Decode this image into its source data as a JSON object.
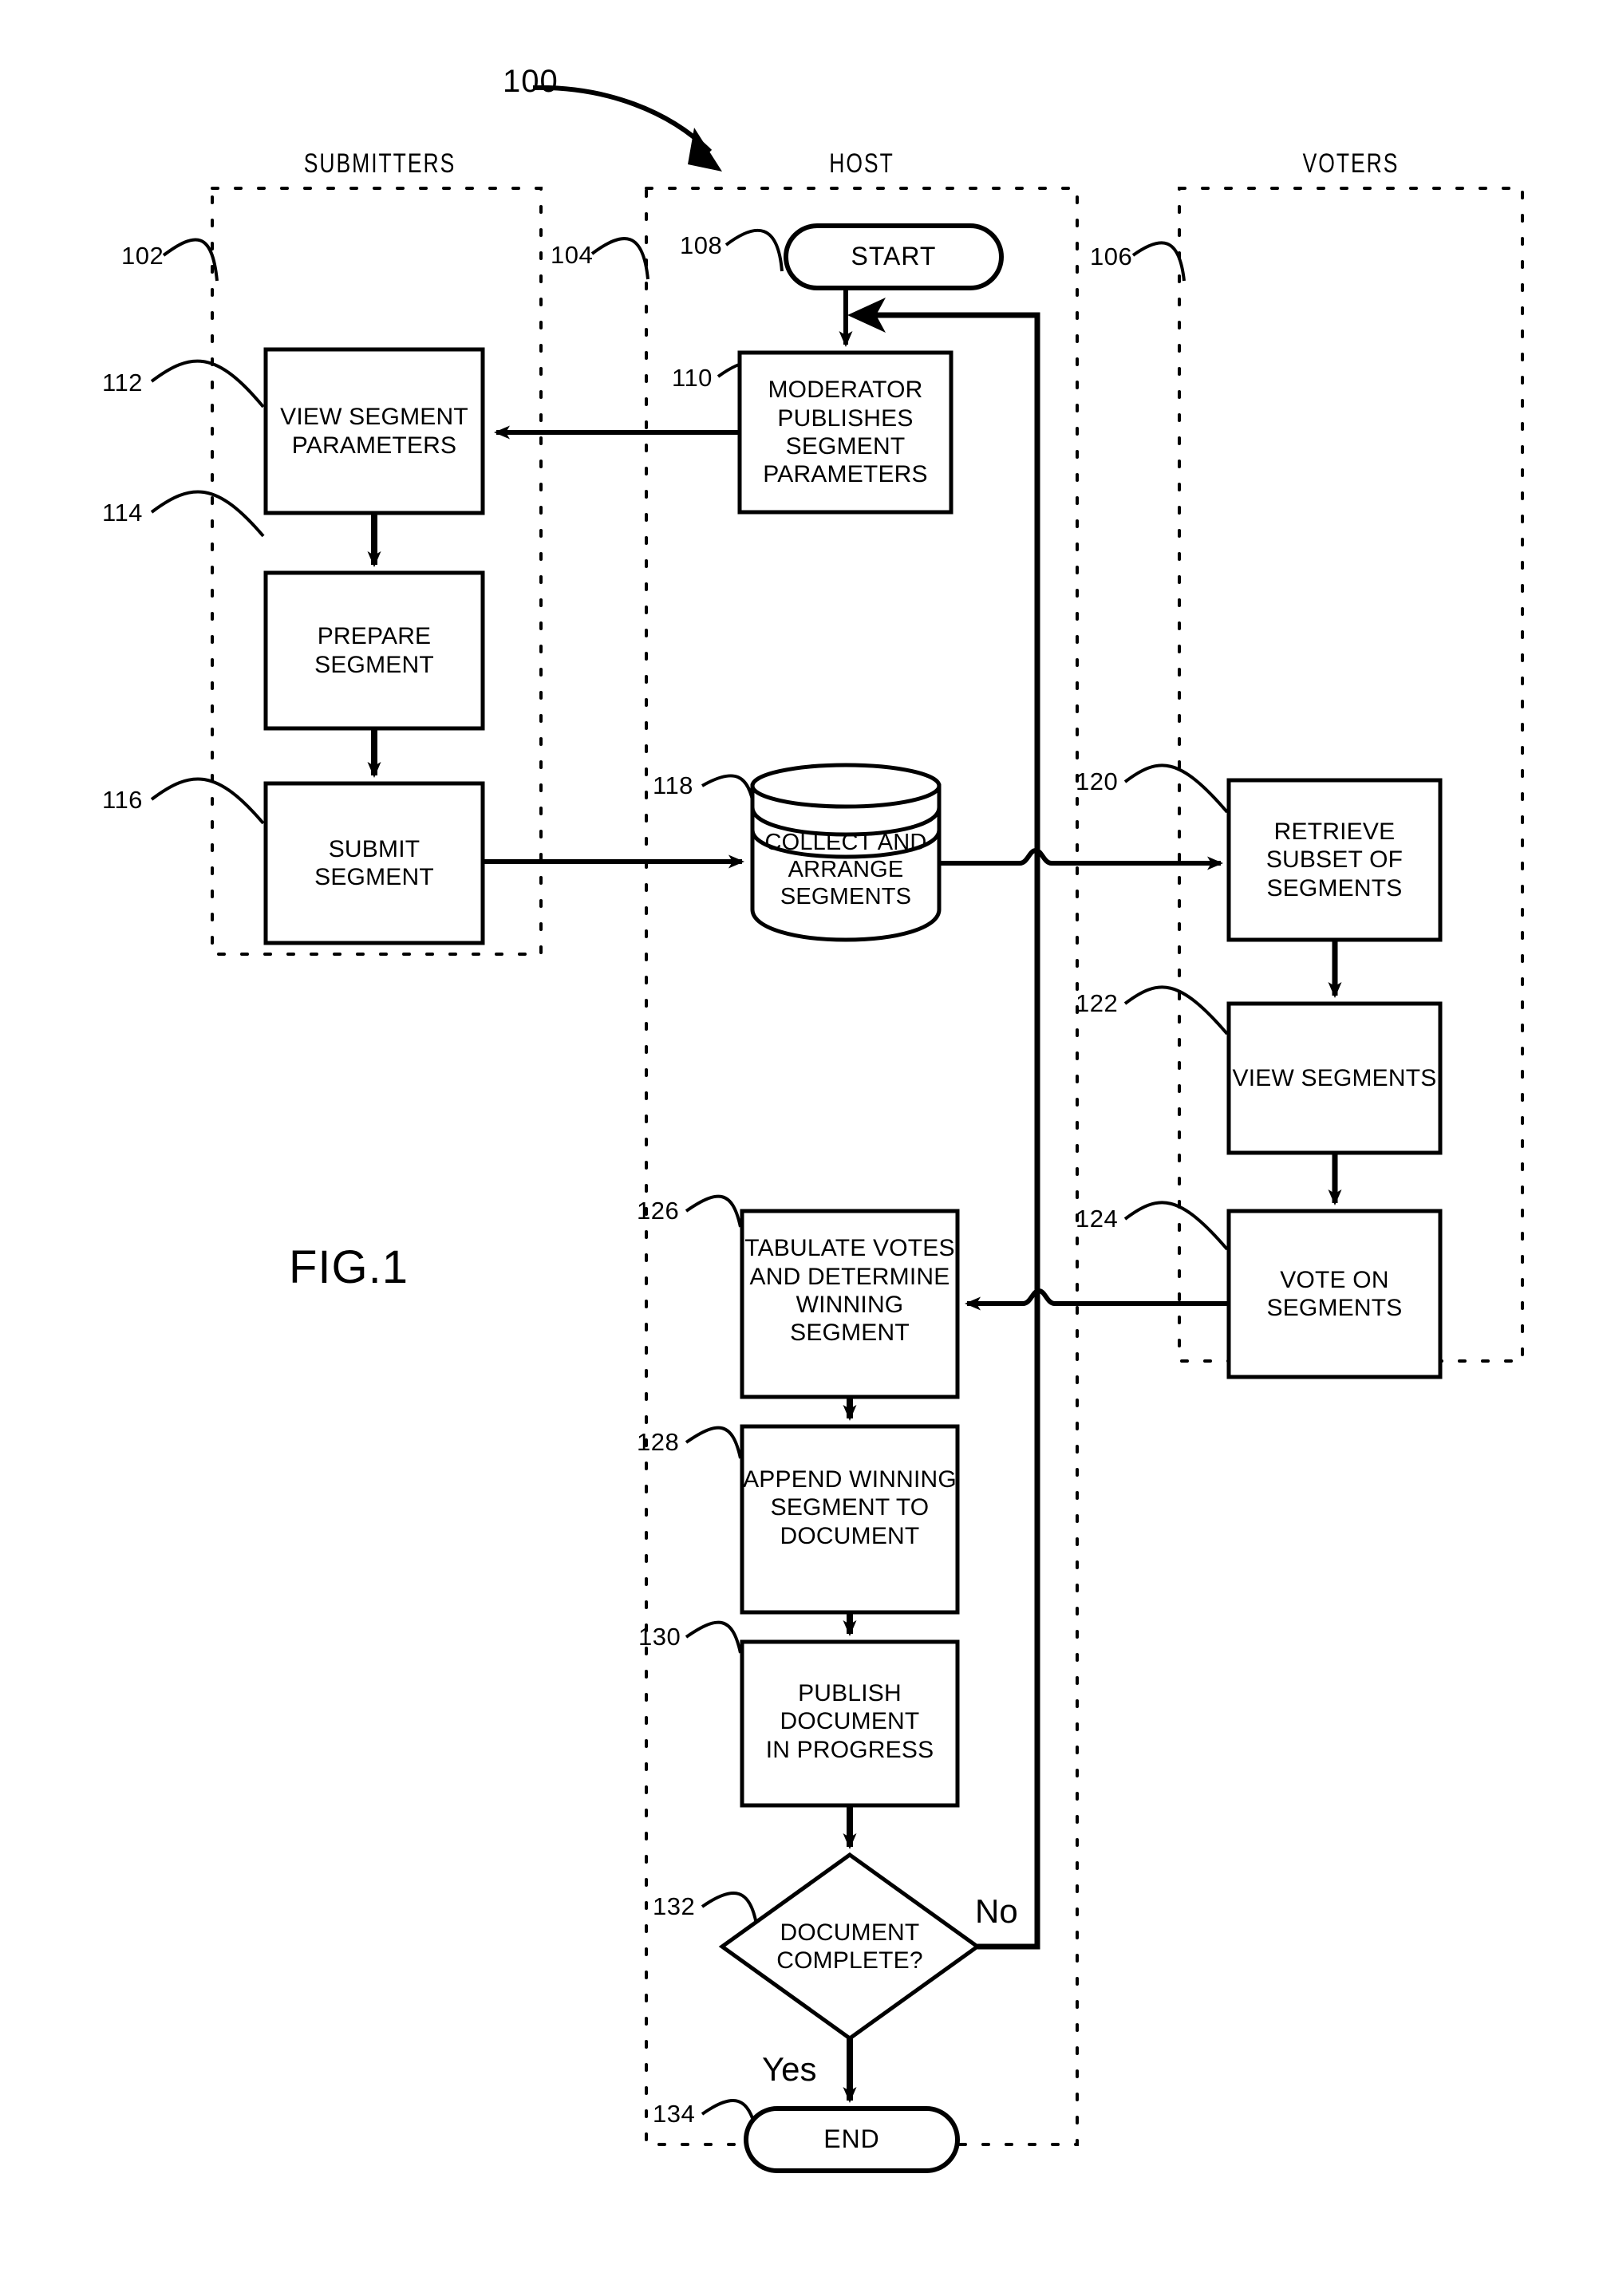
{
  "figure": {
    "label": "FIG.1",
    "system_ref": "100"
  },
  "columns": [
    {
      "title": "SUBMITTERS",
      "ref": "102"
    },
    {
      "title": "HOST",
      "ref": "104"
    },
    {
      "title": "VOTERS",
      "ref": "106"
    }
  ],
  "nodes": {
    "start": {
      "ref": "108",
      "label": "START",
      "shape": "terminator"
    },
    "moderator": {
      "ref": "110",
      "label": "MODERATOR\nPUBLISHES\nSEGMENT\nPARAMETERS",
      "shape": "process"
    },
    "view_params": {
      "ref": "112",
      "label": "VIEW SEGMENT\nPARAMETERS",
      "shape": "process"
    },
    "prepare": {
      "ref": "114",
      "label": "PREPARE\nSEGMENT",
      "shape": "process"
    },
    "submit": {
      "ref": "116",
      "label": "SUBMIT\nSEGMENT",
      "shape": "process"
    },
    "collect": {
      "ref": "118",
      "label": "COLLECT  AND\nARRANGE\nSEGMENTS",
      "shape": "database"
    },
    "retrieve": {
      "ref": "120",
      "label": "RETRIEVE\nSUBSET OF\nSEGMENTS",
      "shape": "process"
    },
    "view_segs": {
      "ref": "122",
      "label": "VIEW SEGMENTS",
      "shape": "process"
    },
    "vote": {
      "ref": "124",
      "label": "VOTE ON\nSEGMENTS",
      "shape": "process"
    },
    "tabulate": {
      "ref": "126",
      "label": "TABULATE VOTES\nAND DETERMINE\nWINNING\nSEGMENT",
      "shape": "process"
    },
    "append": {
      "ref": "128",
      "label": "APPEND WINNING\nSEGMENT TO\nDOCUMENT",
      "shape": "process"
    },
    "publish": {
      "ref": "130",
      "label": "PUBLISH\nDOCUMENT\nIN PROGRESS",
      "shape": "process"
    },
    "decision": {
      "ref": "132",
      "label": "DOCUMENT\nCOMPLETE?",
      "shape": "decision"
    },
    "end": {
      "ref": "134",
      "label": "END",
      "shape": "terminator"
    }
  },
  "edge_labels": {
    "no": "No",
    "yes": "Yes"
  },
  "colors": {
    "stroke": "#000000",
    "background": "#ffffff"
  }
}
